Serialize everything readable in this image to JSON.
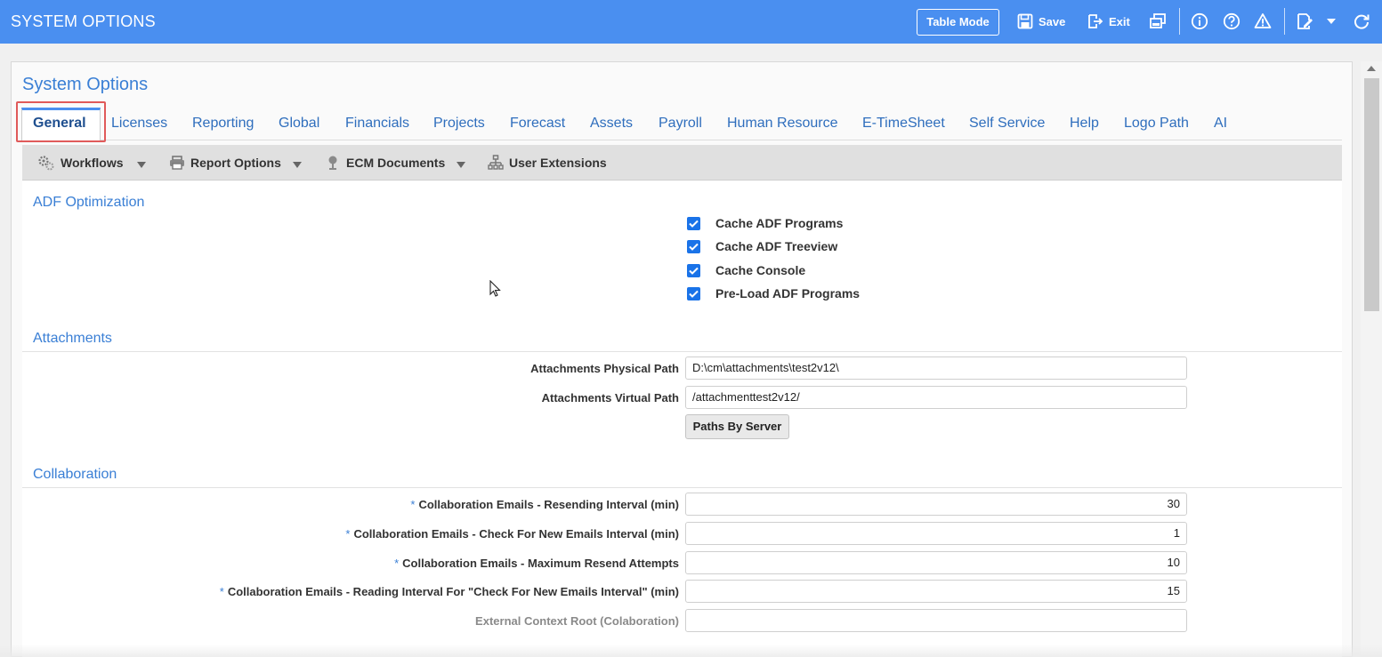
{
  "header": {
    "title": "SYSTEM OPTIONS",
    "table_mode": "Table Mode",
    "save": "Save",
    "exit": "Exit"
  },
  "panel": {
    "title": "System Options"
  },
  "tabs": [
    {
      "label": "General",
      "active": true
    },
    {
      "label": "Licenses"
    },
    {
      "label": "Reporting"
    },
    {
      "label": "Global"
    },
    {
      "label": "Financials"
    },
    {
      "label": "Projects"
    },
    {
      "label": "Forecast"
    },
    {
      "label": "Assets"
    },
    {
      "label": "Payroll"
    },
    {
      "label": "Human Resource"
    },
    {
      "label": "E-TimeSheet"
    },
    {
      "label": "Self Service"
    },
    {
      "label": "Help"
    },
    {
      "label": "Logo Path"
    },
    {
      "label": "AI"
    }
  ],
  "subtoolbar": {
    "workflows": "Workflows",
    "report_options": "Report Options",
    "ecm_documents": "ECM Documents",
    "user_extensions": "User Extensions"
  },
  "adf": {
    "title": "ADF Optimization",
    "options": [
      {
        "label": "Cache ADF Programs",
        "checked": true
      },
      {
        "label": "Cache ADF Treeview",
        "checked": true
      },
      {
        "label": "Cache Console",
        "checked": true
      },
      {
        "label": "Pre-Load ADF Programs",
        "checked": true
      }
    ]
  },
  "attachments": {
    "title": "Attachments",
    "physical_label": "Attachments Physical Path",
    "physical_value": "D:\\cm\\attachments\\test2v12\\",
    "virtual_label": "Attachments Virtual Path",
    "virtual_value": "/attachmenttest2v12/",
    "paths_button": "Paths By Server"
  },
  "collaboration": {
    "title": "Collaboration",
    "req_mark": "*",
    "fields": [
      {
        "label": "Collaboration Emails - Resending Interval (min)",
        "value": "30",
        "required": true
      },
      {
        "label": "Collaboration Emails - Check For New Emails Interval (min)",
        "value": "1",
        "required": true
      },
      {
        "label": "Collaboration Emails - Maximum Resend Attempts",
        "value": "10",
        "required": true
      },
      {
        "label": "Collaboration Emails - Reading Interval For \"Check For New Emails Interval\" (min)",
        "value": "15",
        "required": true
      },
      {
        "label": "External Context Root (Colaboration)",
        "value": "",
        "required": false
      }
    ]
  }
}
